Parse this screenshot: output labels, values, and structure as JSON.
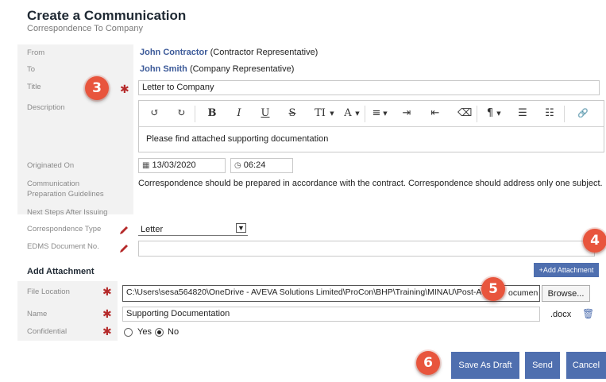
{
  "header": {
    "title": "Create a Communication",
    "subtitle": "Correspondence To Company"
  },
  "form": {
    "from_label": "From",
    "from_name": "John Contractor",
    "from_role": "(Contractor Representative)",
    "to_label": "To",
    "to_name": "John Smith",
    "to_role": "(Company Representative)",
    "title_label": "Title",
    "title_value": "Letter to Company",
    "description_label": "Description",
    "description_text": "Please find attached supporting documentation",
    "originated_label": "Originated On",
    "originated_date": "13/03/2020",
    "originated_time": "06:24",
    "guidelines_label_1": "Communication",
    "guidelines_label_2": "Preparation Guidelines",
    "guidelines_text": "Correspondence should be prepared in accordance with the contract. Correspondence should address only one subject.",
    "next_steps_label": "Next Steps After Issuing",
    "type_label": "Correspondence Type",
    "type_value": "Letter",
    "edms_label": "EDMS Document No.",
    "edms_value": ""
  },
  "toolbar": {
    "undo": "↺",
    "redo": "↻",
    "bold": "B",
    "italic": "I",
    "underline": "U",
    "strike": "S",
    "text_size": "TI",
    "font_color": "A",
    "align": "≡",
    "indent": "⇥",
    "outdent": "⇤",
    "clear": "⌫",
    "paragraph": "¶",
    "bullets": "☰",
    "numbering": "☷",
    "link": "🔗"
  },
  "attachment": {
    "section_title": "Add Attachment",
    "add_button": "+Add Attachment",
    "file_location_label": "File Location",
    "file_location_value": "C:\\Users\\sesa564820\\OneDrive - AVEVA Solutions Limited\\ProCon\\BHP\\Training\\MINAU\\Post-A",
    "file_location_tail": "ocumen",
    "browse_label": "Browse...",
    "name_label": "Name",
    "name_value": "Supporting Documentation",
    "extension": ".docx",
    "confidential_label": "Confidential",
    "yes_label": "Yes",
    "no_label": "No",
    "confidential_selected": "No"
  },
  "actions": {
    "save_draft": "Save As Draft",
    "send": "Send",
    "cancel": "Cancel"
  },
  "badges": {
    "b3": "3",
    "b4": "4",
    "b5": "5",
    "b6": "6"
  },
  "colors": {
    "badge": "#e8553d",
    "primary_button": "#4f6faf",
    "name_link": "#3c5a99",
    "required": "#b52a2a"
  },
  "icons": {
    "calendar": "calendar-icon",
    "clock": "clock-icon",
    "pencil": "pencil-icon",
    "trash": "trash-icon",
    "required": "asterisk-icon"
  }
}
